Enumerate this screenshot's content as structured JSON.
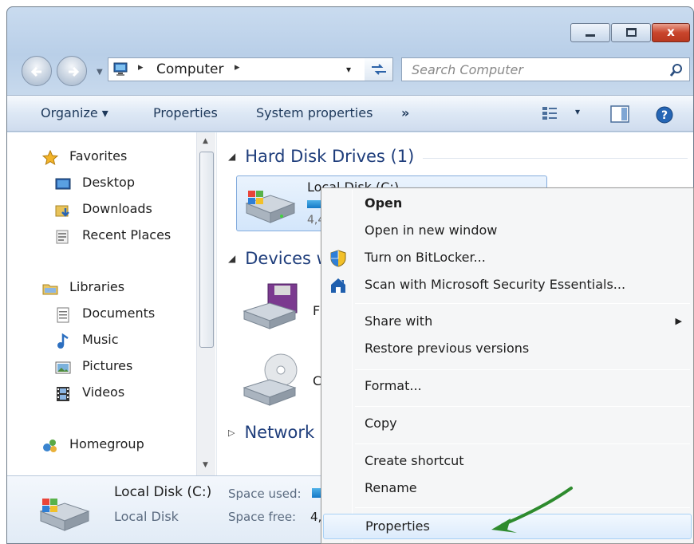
{
  "window": {
    "controls": {
      "minimize_icon": "minimize-icon",
      "maximize_icon": "maximize-icon",
      "close_icon": "close-icon",
      "close_glyph": "x"
    },
    "accent_close": "#c9452c"
  },
  "address_bar": {
    "crumbs": [
      "Computer"
    ],
    "separator": "▸",
    "dropdown_glyph": "▾"
  },
  "search": {
    "placeholder": "Search Computer"
  },
  "toolbar": {
    "organize": "Organize ▾",
    "properties": "Properties",
    "system_properties": "System properties",
    "more": "»",
    "views_glyph": "▾"
  },
  "nav": {
    "favorites": {
      "label": "Favorites",
      "items": [
        "Desktop",
        "Downloads",
        "Recent Places"
      ]
    },
    "libraries": {
      "label": "Libraries",
      "items": [
        "Documents",
        "Music",
        "Pictures",
        "Videos"
      ]
    },
    "homegroup": "Homegroup"
  },
  "content": {
    "groups": {
      "hard_disks": "Hard Disk Drives (1)",
      "devices": "Devices w",
      "network": "Network l"
    },
    "local_disk": {
      "name": "Local Disk (C:)",
      "size_fragment": "4,4"
    },
    "devices": {
      "floppy": "Flo",
      "cd": "CD"
    }
  },
  "details": {
    "name": "Local Disk (C:)",
    "type": "Local Disk",
    "space_used_label": "Space used:",
    "space_free_label": "Space free:",
    "space_free_value": "4,4"
  },
  "context_menu": {
    "open": "Open",
    "open_new_window": "Open in new window",
    "bitlocker": "Turn on BitLocker...",
    "scan": "Scan with Microsoft Security Essentials...",
    "share_with": "Share with",
    "submenu_glyph": "▶",
    "restore": "Restore previous versions",
    "format": "Format...",
    "copy": "Copy",
    "create_shortcut": "Create shortcut",
    "rename": "Rename",
    "properties": "Properties"
  },
  "colors": {
    "arrow": "#2e8b2e",
    "group_heading": "#1e3d7b",
    "highlight": "#dcebfc"
  }
}
